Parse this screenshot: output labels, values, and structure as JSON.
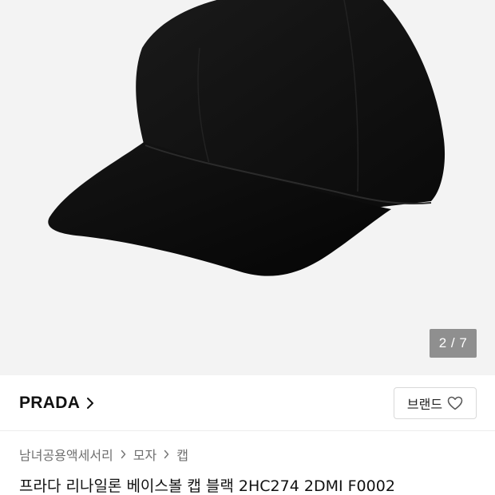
{
  "gallery": {
    "image_alt": "black baseball cap",
    "page_indicator": "2 / 7",
    "background": "#f3f3f3"
  },
  "brand": {
    "name": "PRADA",
    "like_button_label": "브랜드"
  },
  "breadcrumb": {
    "items": [
      "남녀공용액세서리",
      "모자",
      "캡"
    ]
  },
  "product": {
    "title": "프라다 리나일론 베이스볼 캡 블랙 2HC274 2DMI F0002"
  },
  "icons": {
    "brand_chevron": "chevron-right-icon",
    "like": "heart-outline-icon",
    "breadcrumb_separator": "chevron-right-icon"
  }
}
